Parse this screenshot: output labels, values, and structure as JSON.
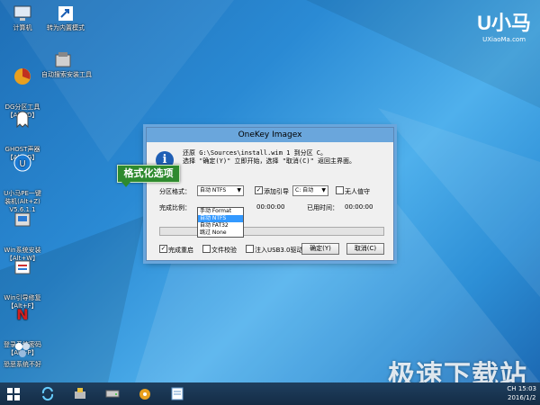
{
  "brand": {
    "logo": "U小马",
    "url": "UXiaoMa.com"
  },
  "watermark": "极速下载站",
  "desktop_icons": [
    {
      "label": "计算机",
      "icon": "computer-icon"
    },
    {
      "label": "转为内置模式",
      "icon": "shortcut-icon"
    },
    {
      "label": "DG分区工具\n【Alt+D】",
      "icon": "partition-tool-icon"
    },
    {
      "label": "自动搜索安装工具",
      "icon": "auto-install-icon"
    },
    {
      "label": "GHOST声器\n【Alt+G】",
      "icon": "ghost-icon"
    },
    {
      "label": "U小马PE一键\n装机(Alt+Z)\nV5.6.1.1",
      "icon": "installer-icon"
    },
    {
      "label": "Win系统安装\n【Alt+W】",
      "icon": "win-install-icon"
    },
    {
      "label": "Win引导修复\n【Alt+F】",
      "icon": "boot-repair-icon"
    },
    {
      "label": "登录系统密码\n【Alt+P】",
      "icon": "password-icon"
    },
    {
      "label": "恐恶系统不好",
      "icon": "system-icon"
    }
  ],
  "dialog": {
    "title": "OneKey Imagex",
    "message_line1": "还原 G:\\Sources\\install.wim 1 到分区 C。",
    "message_line2": "选择 \"确定(Y)\" 立即开始，选择 \"取消(C)\" 返回主界面。",
    "partition_format_label": "分区格式：",
    "partition_format_value": "自动 NTFS",
    "dropdown_options": [
      "手动 Format",
      "自动 NTFS",
      "自动 FAT32",
      "跳过 None"
    ],
    "dropdown_selected_index": 1,
    "add_boot_label": "添加引导",
    "add_boot_checked": true,
    "drive_value": "C: 自动",
    "no_prompt_label": "无人值守",
    "no_prompt_checked": false,
    "progress_label": "完成比例：",
    "remaining_time": "00:00:00",
    "elapsed_label": "已用时间：",
    "elapsed_time": "00:00:00",
    "progress_fraction": 0.0,
    "reboot_label": "完成重启",
    "reboot_checked": true,
    "verify_label": "文件校验",
    "verify_checked": false,
    "usb3_label": "注入USB3.0驱动",
    "usb3_checked": false,
    "ok_button": "确定(Y)",
    "cancel_button": "取消(C)"
  },
  "callout": "格式化选项",
  "taskbar": {
    "items": [
      "start-icon",
      "refresh-icon",
      "tool-icon",
      "drive-icon",
      "settings-icon",
      "notes-icon"
    ],
    "tray_time": "15:03",
    "tray_date": "2016/1/2",
    "tray_lang": "CH"
  }
}
